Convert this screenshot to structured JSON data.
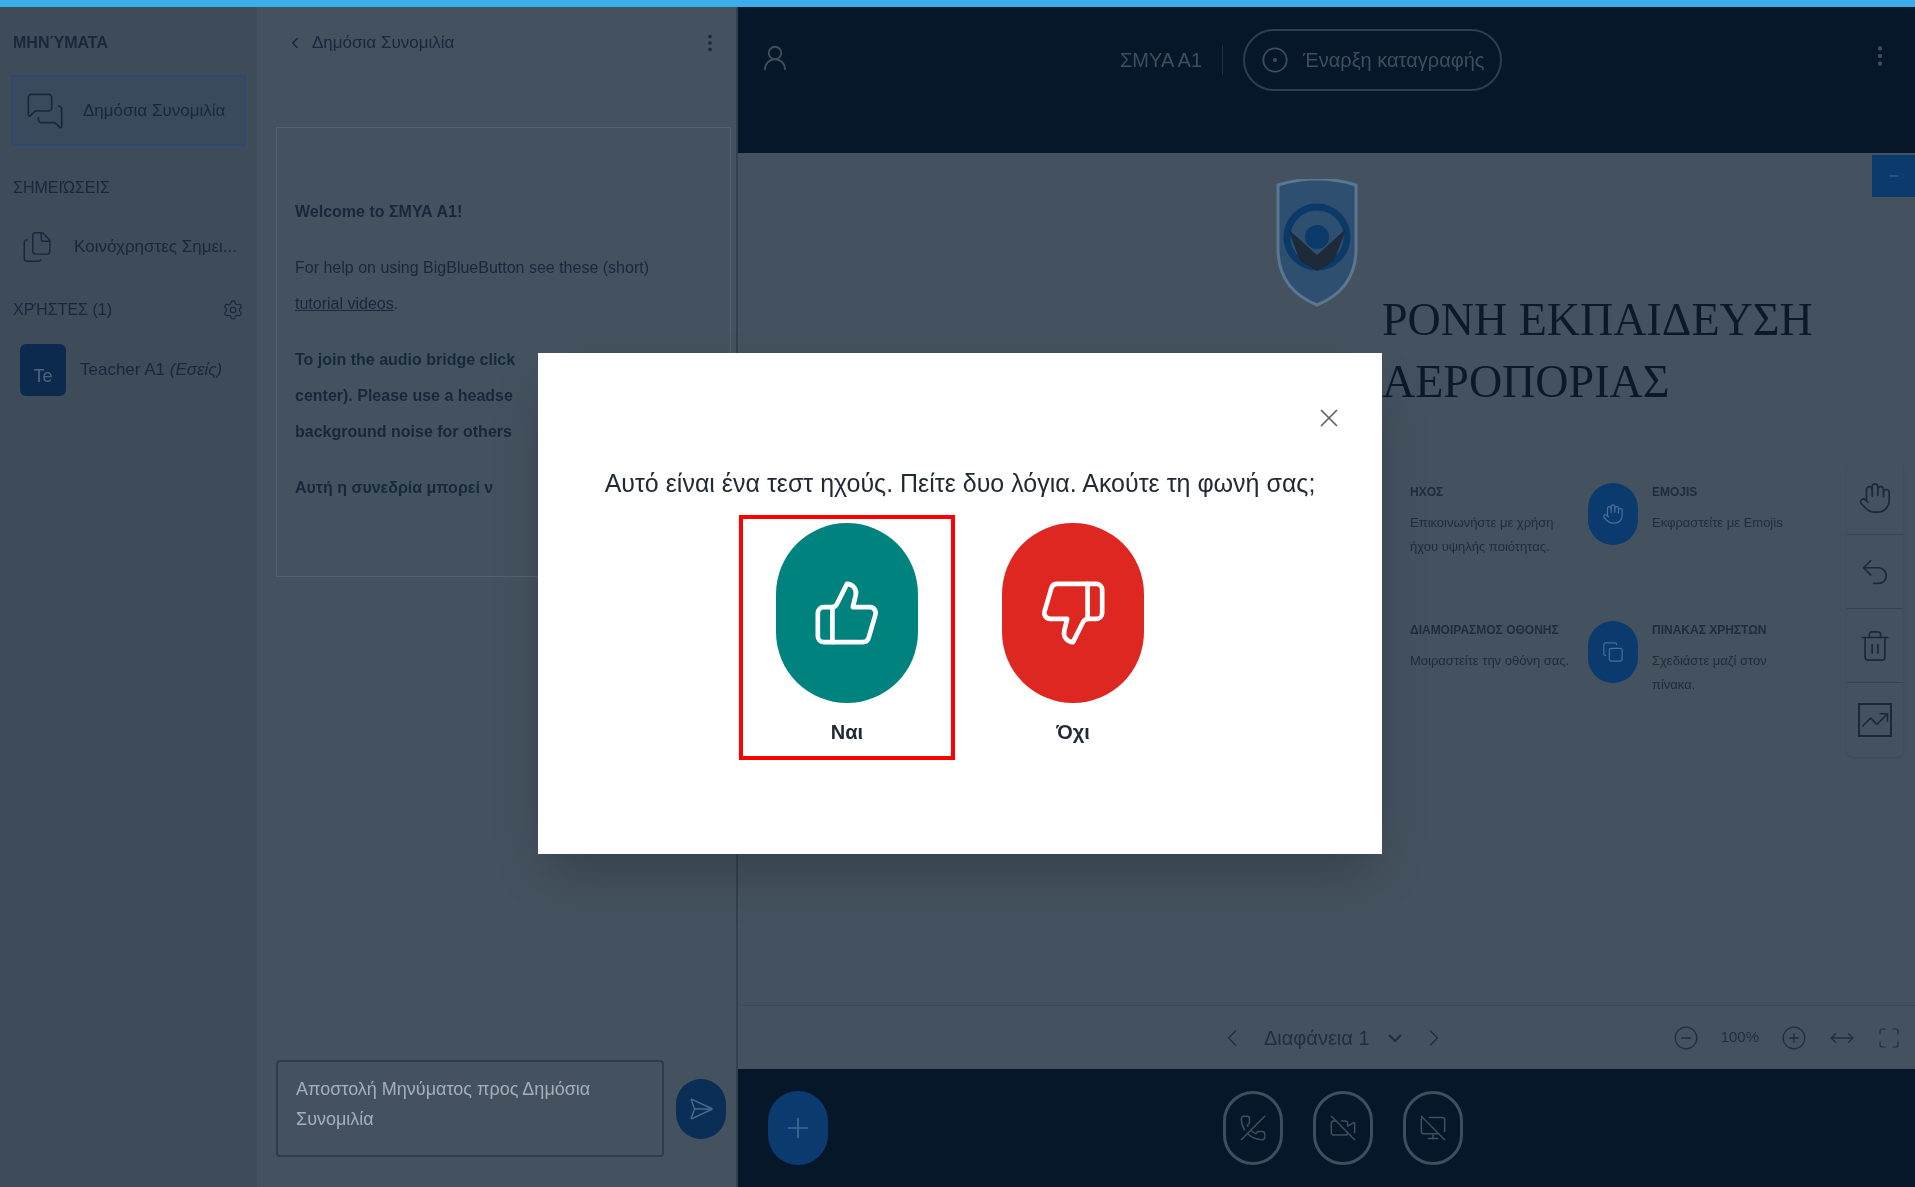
{
  "nav": {
    "messages_heading": "ΜΗΝΎΜΑΤΑ",
    "chats": [
      {
        "label": "Δημόσια Συνομιλία",
        "selected": true
      }
    ],
    "notes_heading": "ΣΗΜΕΙΏΣΕΙΣ",
    "notes": [
      {
        "label": "Κοινόχρηστες Σημει..."
      }
    ],
    "users_heading": "ΧΡΉΣΤΕΣ (1)",
    "users": [
      {
        "avatar": "Te",
        "name": "Teacher A1",
        "suffix": "(Εσείς)"
      }
    ]
  },
  "chat": {
    "title": "Δημόσια Συνομιλία",
    "welcome": "Welcome to **ΣΜΥΑ Α1**!",
    "help_before": "For help on using BigBlueButton see these (short)",
    "help_link": "tutorial videos",
    "help_after": ".",
    "audio_lines": [
      "To join the audio bridge click",
      "center). Please use a headse",
      "background noise for others"
    ],
    "session_line": "Αυτή η συνεδρία μπορεί ν",
    "input": {
      "placeholder": "Αποστολή Μηνύματος προς Δημόσια Συνομιλία"
    }
  },
  "top_bar": {
    "title": "ΣΜΥΑ Α1",
    "record_button": "Έναρξη καταγραφής"
  },
  "slide": {
    "title_lines": [
      "ΡΟΝΗ ΕΚΠΑΙΔΕΥΣΗ",
      "ΑΕΡΟΠΟΡΙΑΣ"
    ],
    "features": [
      {
        "kind": "sound",
        "title": "ΗΧΟΣ",
        "description": "Επικοινωνήστε με χρήση ήχου υψηλής ποιότητας."
      },
      {
        "kind": "emoji",
        "title": "EMOJIS",
        "description": "Εκφραστείτε με Emojis"
      },
      {
        "kind": "screen",
        "title": "ΔΙΑΜΟΙΡΑΣΜΟΣ ΟΘΟΝΗΣ",
        "description": "Μοιραστείτε την οθόνη σας."
      },
      {
        "kind": "whiteboard",
        "title": "ΠΙΝΑΚΑΣ ΧΡΗΣΤΩΝ",
        "description": "Σχεδιάστε μαζί στον πίνακα."
      }
    ]
  },
  "slide_controls": {
    "slide_label": "Διαφάνεια 1",
    "zoom": "100%"
  },
  "dialog": {
    "question": "Αυτό είναι ένα τεστ ηχούς. Πείτε δυο λόγια. Ακούτε τη φωνή σας;",
    "options": [
      {
        "kind": "yes",
        "label": "Ναι",
        "selected": true,
        "color": "#00827f"
      },
      {
        "kind": "no",
        "label": "Όχι",
        "selected": false,
        "color": "#de2721"
      }
    ]
  }
}
